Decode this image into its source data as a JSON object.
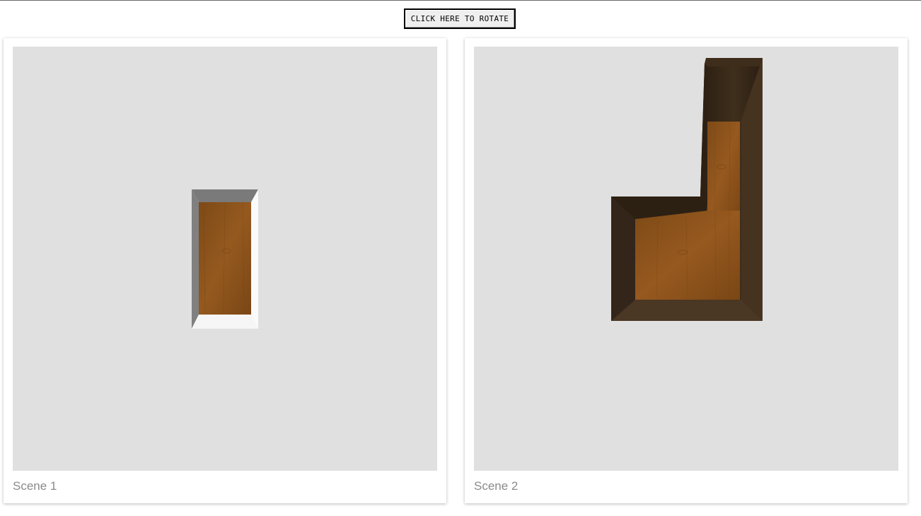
{
  "toolbar": {
    "rotate_label": "CLICK HERE TO ROTATE"
  },
  "scenes": [
    {
      "caption": "Scene 1"
    },
    {
      "caption": "Scene 2"
    }
  ],
  "colors": {
    "viewport_bg": "#e0e0e0",
    "wood_light": "#8a531c",
    "wood_dark": "#3d2c1a",
    "wall_gray": "#7a7a7a",
    "wall_white": "#f4f4f4"
  }
}
